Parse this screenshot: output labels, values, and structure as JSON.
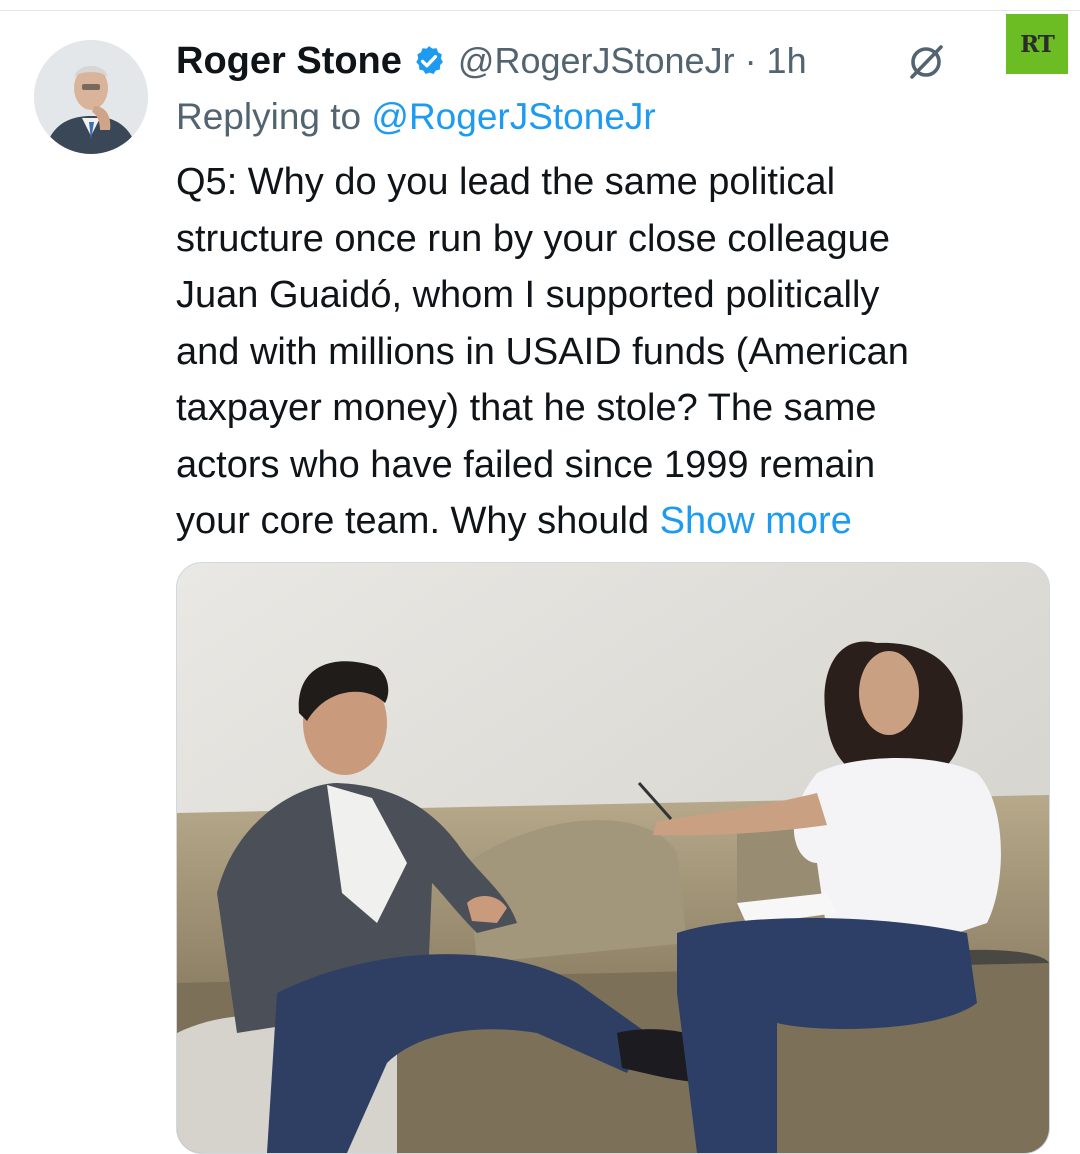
{
  "tweet": {
    "display_name": "Roger Stone",
    "handle_time": "@RogerJStoneJr · 1h",
    "replying_prefix": "Replying to",
    "replying_handle": "@RogerJStoneJr",
    "text_lines": [
      "Q5: Why do you lead the same political",
      "structure once run by your close colleague",
      "Juan Guaidó, whom I supported politically",
      "and with millions in USAID funds (American",
      "taxpayer money) that he stole? The same",
      "actors who have failed since 1999 remain",
      "your core team. Why should"
    ],
    "show_more": "Show more"
  },
  "watermark": {
    "label": "RT",
    "color": "#6cbd24"
  },
  "icons": {
    "verified": "verified-badge-icon",
    "grok": "grok-icon"
  },
  "colors": {
    "accent": "#1d9bf0",
    "text": "#0f1419",
    "muted": "#536471"
  }
}
